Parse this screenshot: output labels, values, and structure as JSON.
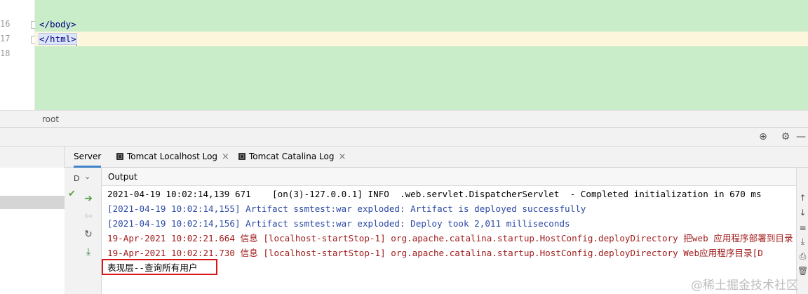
{
  "editor": {
    "line_numbers": [
      "16",
      "17",
      "18"
    ],
    "lines": [
      "</body>",
      "</html>",
      ""
    ]
  },
  "breadcrumb": {
    "text": "root"
  },
  "services": {
    "deploy_label": "D",
    "tabs": [
      {
        "label": "Server"
      },
      {
        "label": "Tomcat Localhost Log"
      },
      {
        "label": "Tomcat Catalina Log"
      }
    ],
    "output_header": "Output",
    "output_lines": [
      {
        "text": "2021-04-19 10:02:14,139 671    [on(3)-127.0.0.1] INFO  .web.servlet.DispatcherServlet  - Completed initialization in 670 ms",
        "color": "black"
      },
      {
        "text": "[2021-04-19 10:02:14,155] Artifact ssmtest:war exploded: Artifact is deployed successfully",
        "color": "blue"
      },
      {
        "text": "[2021-04-19 10:02:14,156] Artifact ssmtest:war exploded: Deploy took 2,011 milliseconds",
        "color": "blue"
      },
      {
        "text": "19-Apr-2021 10:02:21.664 信息 [localhost-startStop-1] org.apache.catalina.startup.HostConfig.deployDirectory 把web 应用程序部署到目录",
        "color": "red"
      },
      {
        "text": "19-Apr-2021 10:02:21.730 信息 [localhost-startStop-1] org.apache.catalina.startup.HostConfig.deployDirectory Web应用程序目录[D",
        "color": "red"
      },
      {
        "text": "表现层--查询所有用户",
        "color": "black"
      }
    ]
  },
  "watermark": {
    "text": "@稀土掘金技术社区"
  },
  "colors": {
    "accent": "#4083c9",
    "highlight_box": "#d9171b",
    "editor_bg": "#c9ecc9"
  }
}
